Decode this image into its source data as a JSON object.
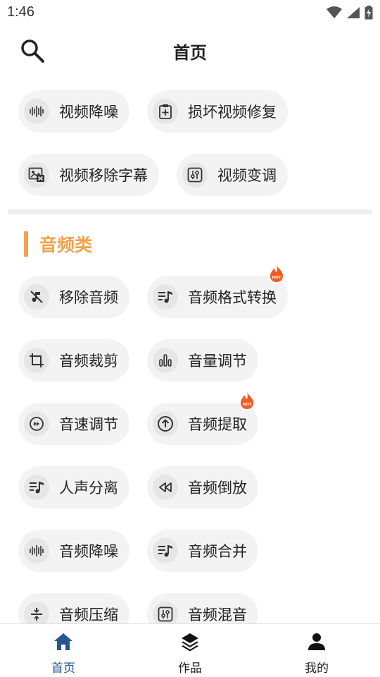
{
  "status_bar": {
    "time": "1:46"
  },
  "header": {
    "title": "首页"
  },
  "video_tools": [
    {
      "label": "视频降噪",
      "icon": "waveform-icon"
    },
    {
      "label": "损坏视频修复",
      "icon": "repair-clipboard-icon"
    },
    {
      "label": "视频移除字幕",
      "icon": "remove-subtitle-icon"
    },
    {
      "label": "视频变调",
      "icon": "equalizer-box-icon"
    }
  ],
  "audio_section": {
    "title": "音频类"
  },
  "audio_tools": [
    {
      "label": "移除音频",
      "icon": "music-off-icon",
      "hot": false
    },
    {
      "label": "音频格式转换",
      "icon": "playlist-music-icon",
      "hot": true
    },
    {
      "label": "音频裁剪",
      "icon": "crop-icon",
      "hot": false
    },
    {
      "label": "音量调节",
      "icon": "volume-bars-icon",
      "hot": false
    },
    {
      "label": "音速调节",
      "icon": "speed-icon",
      "hot": false
    },
    {
      "label": "音频提取",
      "icon": "upload-circle-icon",
      "hot": true
    },
    {
      "label": "人声分离",
      "icon": "playlist-music-icon",
      "hot": false
    },
    {
      "label": "音频倒放",
      "icon": "rewind-icon",
      "hot": false
    },
    {
      "label": "音频降噪",
      "icon": "waveform-icon",
      "hot": false
    },
    {
      "label": "音频合并",
      "icon": "playlist-music-icon",
      "hot": false
    },
    {
      "label": "音频压缩",
      "icon": "divide-icon",
      "hot": false
    },
    {
      "label": "音频混音",
      "icon": "equalizer-box-icon",
      "hot": false
    }
  ],
  "hot_badge_text": "HOT",
  "bottom_nav": [
    {
      "label": "首页",
      "icon": "home-icon",
      "active": true
    },
    {
      "label": "作品",
      "icon": "layers-icon",
      "active": false
    },
    {
      "label": "我的",
      "icon": "person-icon",
      "active": false
    }
  ],
  "colors": {
    "accent": "#f6a14b",
    "nav_active": "#27558f",
    "chip_bg": "#f3f3f3",
    "hot": "#f25a1f"
  }
}
